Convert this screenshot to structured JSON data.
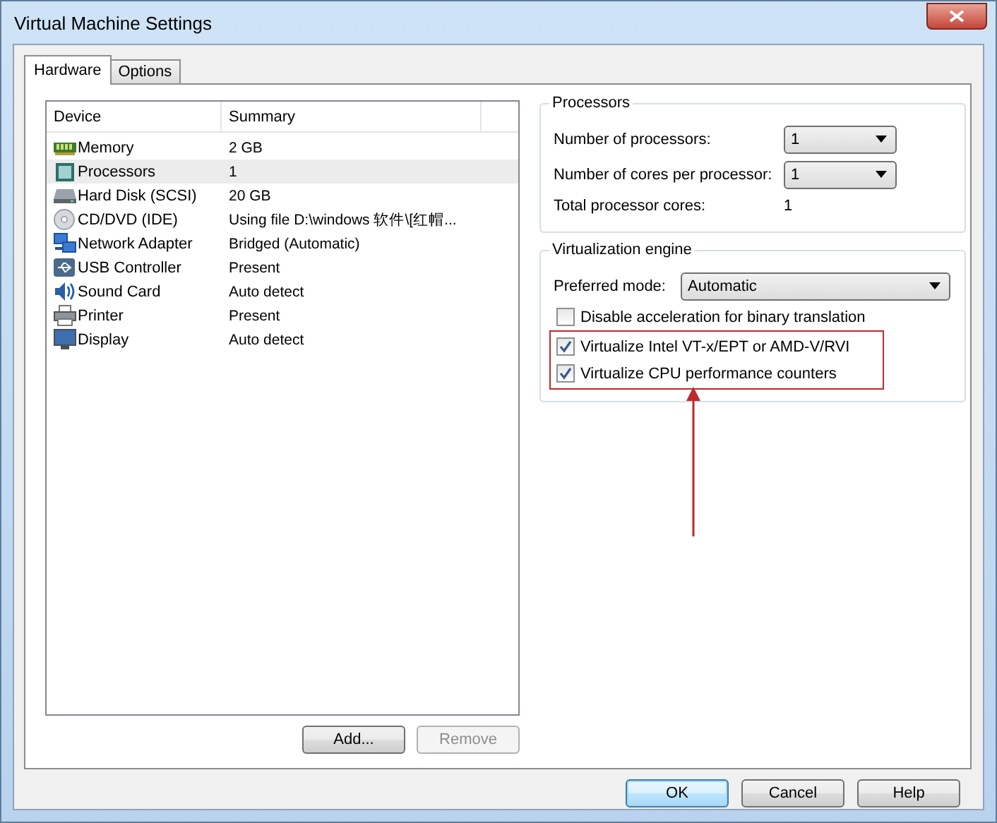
{
  "window": {
    "title": "Virtual Machine Settings"
  },
  "tabs": [
    {
      "label": "Hardware",
      "selected": true
    },
    {
      "label": "Options",
      "selected": false
    }
  ],
  "device_table": {
    "columns": [
      "Device",
      "Summary"
    ],
    "rows": [
      {
        "kind": "memory",
        "device": "Memory",
        "summary": "2 GB",
        "selected": false
      },
      {
        "kind": "processor",
        "device": "Processors",
        "summary": "1",
        "selected": true
      },
      {
        "kind": "disk",
        "device": "Hard Disk (SCSI)",
        "summary": "20 GB",
        "selected": false
      },
      {
        "kind": "cd",
        "device": "CD/DVD (IDE)",
        "summary": "Using file D:\\windows 软件\\[红帽...",
        "selected": false
      },
      {
        "kind": "network",
        "device": "Network Adapter",
        "summary": "Bridged (Automatic)",
        "selected": false
      },
      {
        "kind": "usb",
        "device": "USB Controller",
        "summary": "Present",
        "selected": false
      },
      {
        "kind": "sound",
        "device": "Sound Card",
        "summary": "Auto detect",
        "selected": false
      },
      {
        "kind": "printer",
        "device": "Printer",
        "summary": "Present",
        "selected": false
      },
      {
        "kind": "display",
        "device": "Display",
        "summary": "Auto detect",
        "selected": false
      }
    ]
  },
  "list_buttons": [
    {
      "label": "Add...",
      "disabled": false
    },
    {
      "label": "Remove",
      "disabled": true
    }
  ],
  "processors": {
    "title": "Processors",
    "fields": [
      {
        "label": "Number of processors:",
        "value": "1"
      },
      {
        "label": "Number of cores per processor:",
        "value": "1"
      }
    ],
    "total_label": "Total processor cores:",
    "total_value": "1"
  },
  "virtualization": {
    "title": "Virtualization engine",
    "mode_label": "Preferred mode:",
    "mode_value": "Automatic",
    "options": [
      {
        "label": "Disable acceleration for binary translation",
        "checked": false,
        "highlighted": false
      },
      {
        "label": "Virtualize Intel VT-x/EPT or AMD-V/RVI",
        "checked": true,
        "highlighted": true
      },
      {
        "label": "Virtualize CPU performance counters",
        "checked": true,
        "highlighted": true
      }
    ]
  },
  "dialog_buttons": [
    {
      "label": "OK",
      "default": true
    },
    {
      "label": "Cancel",
      "default": false
    },
    {
      "label": "Help",
      "default": false
    }
  ]
}
